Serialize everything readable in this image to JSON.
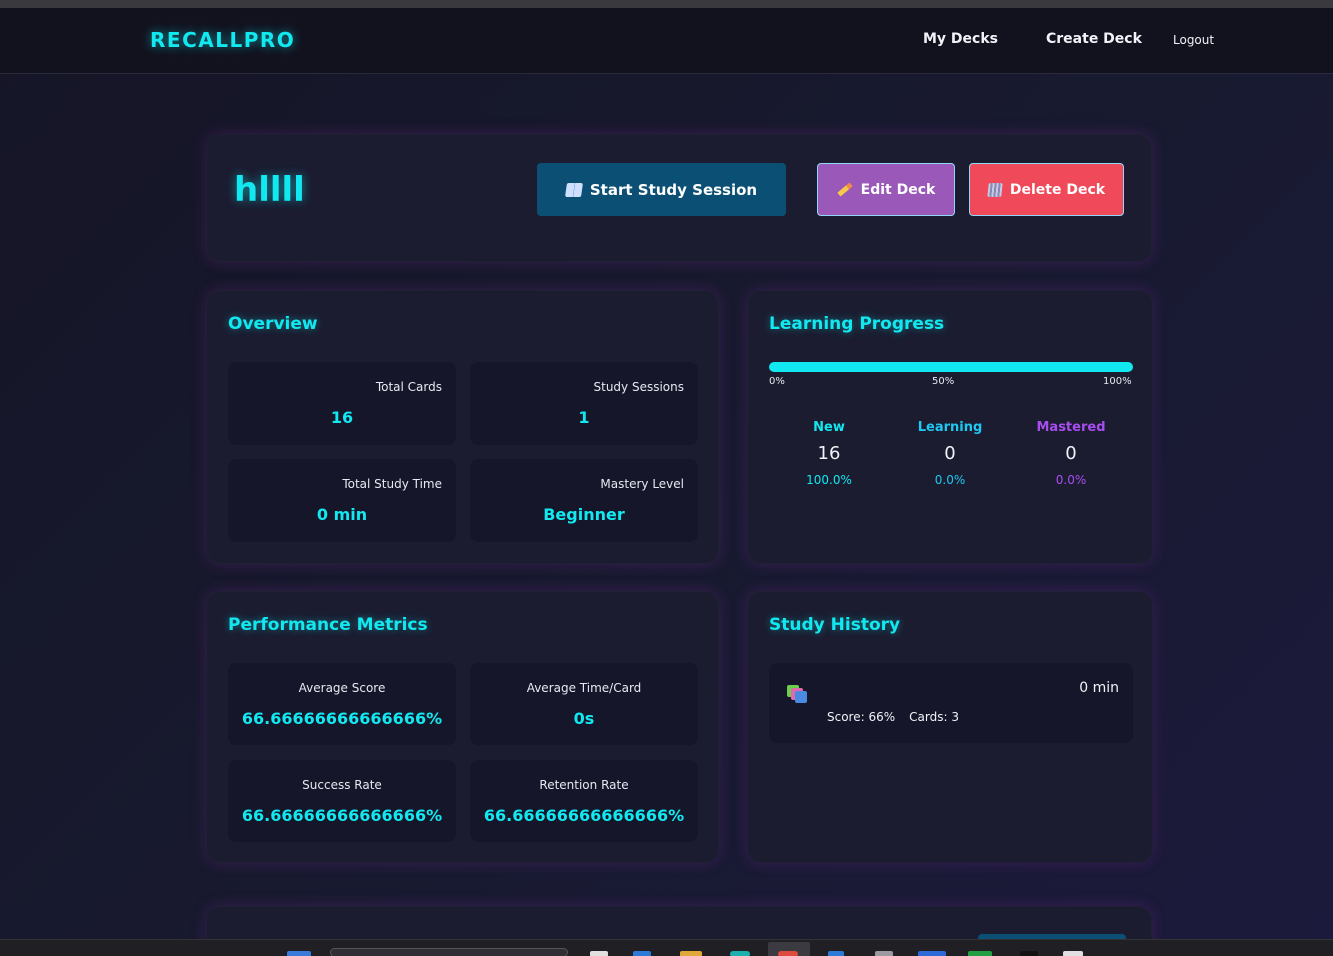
{
  "nav": {
    "brand": "RECALLPRO",
    "links": [
      "My Decks",
      "Create Deck",
      "Logout"
    ]
  },
  "deck": {
    "title": "hllll",
    "buttons": {
      "study": "Start Study Session",
      "edit": "Edit Deck",
      "delete": "Delete Deck"
    }
  },
  "overview": {
    "title": "Overview",
    "stats": [
      {
        "label": "Total Cards",
        "value": "16"
      },
      {
        "label": "Study Sessions",
        "value": "1"
      },
      {
        "label": "Total Study Time",
        "value": "0 min"
      },
      {
        "label": "Mastery Level",
        "value": "Beginner"
      }
    ]
  },
  "progress": {
    "title": "Learning Progress",
    "fill_percent": 100,
    "ticks": [
      "0%",
      "50%",
      "100%"
    ],
    "columns": [
      {
        "name": "New",
        "count": "16",
        "pct": "100.0%",
        "color": "#12e8f0"
      },
      {
        "name": "Learning",
        "count": "0",
        "pct": "0.0%",
        "color": "#1ec8f0"
      },
      {
        "name": "Mastered",
        "count": "0",
        "pct": "0.0%",
        "color": "#a84ef0"
      }
    ]
  },
  "performance": {
    "title": "Performance Metrics",
    "stats": [
      {
        "label": "Average Score",
        "value": "66.66666666666666%"
      },
      {
        "label": "Average Time/Card",
        "value": "0s"
      },
      {
        "label": "Success Rate",
        "value": "66.66666666666666%"
      },
      {
        "label": "Retention Rate",
        "value": "66.66666666666666%"
      }
    ]
  },
  "history": {
    "title": "Study History",
    "items": [
      {
        "duration": "0 min",
        "score": "Score: 66%",
        "cards": "Cards: 3",
        "icon": "card-stack-icon"
      }
    ]
  },
  "colors": {
    "accent": "#12e8f0",
    "study_button": "#0b5074",
    "edit_button": "#9a58b8",
    "delete_button": "#f04a5a"
  }
}
